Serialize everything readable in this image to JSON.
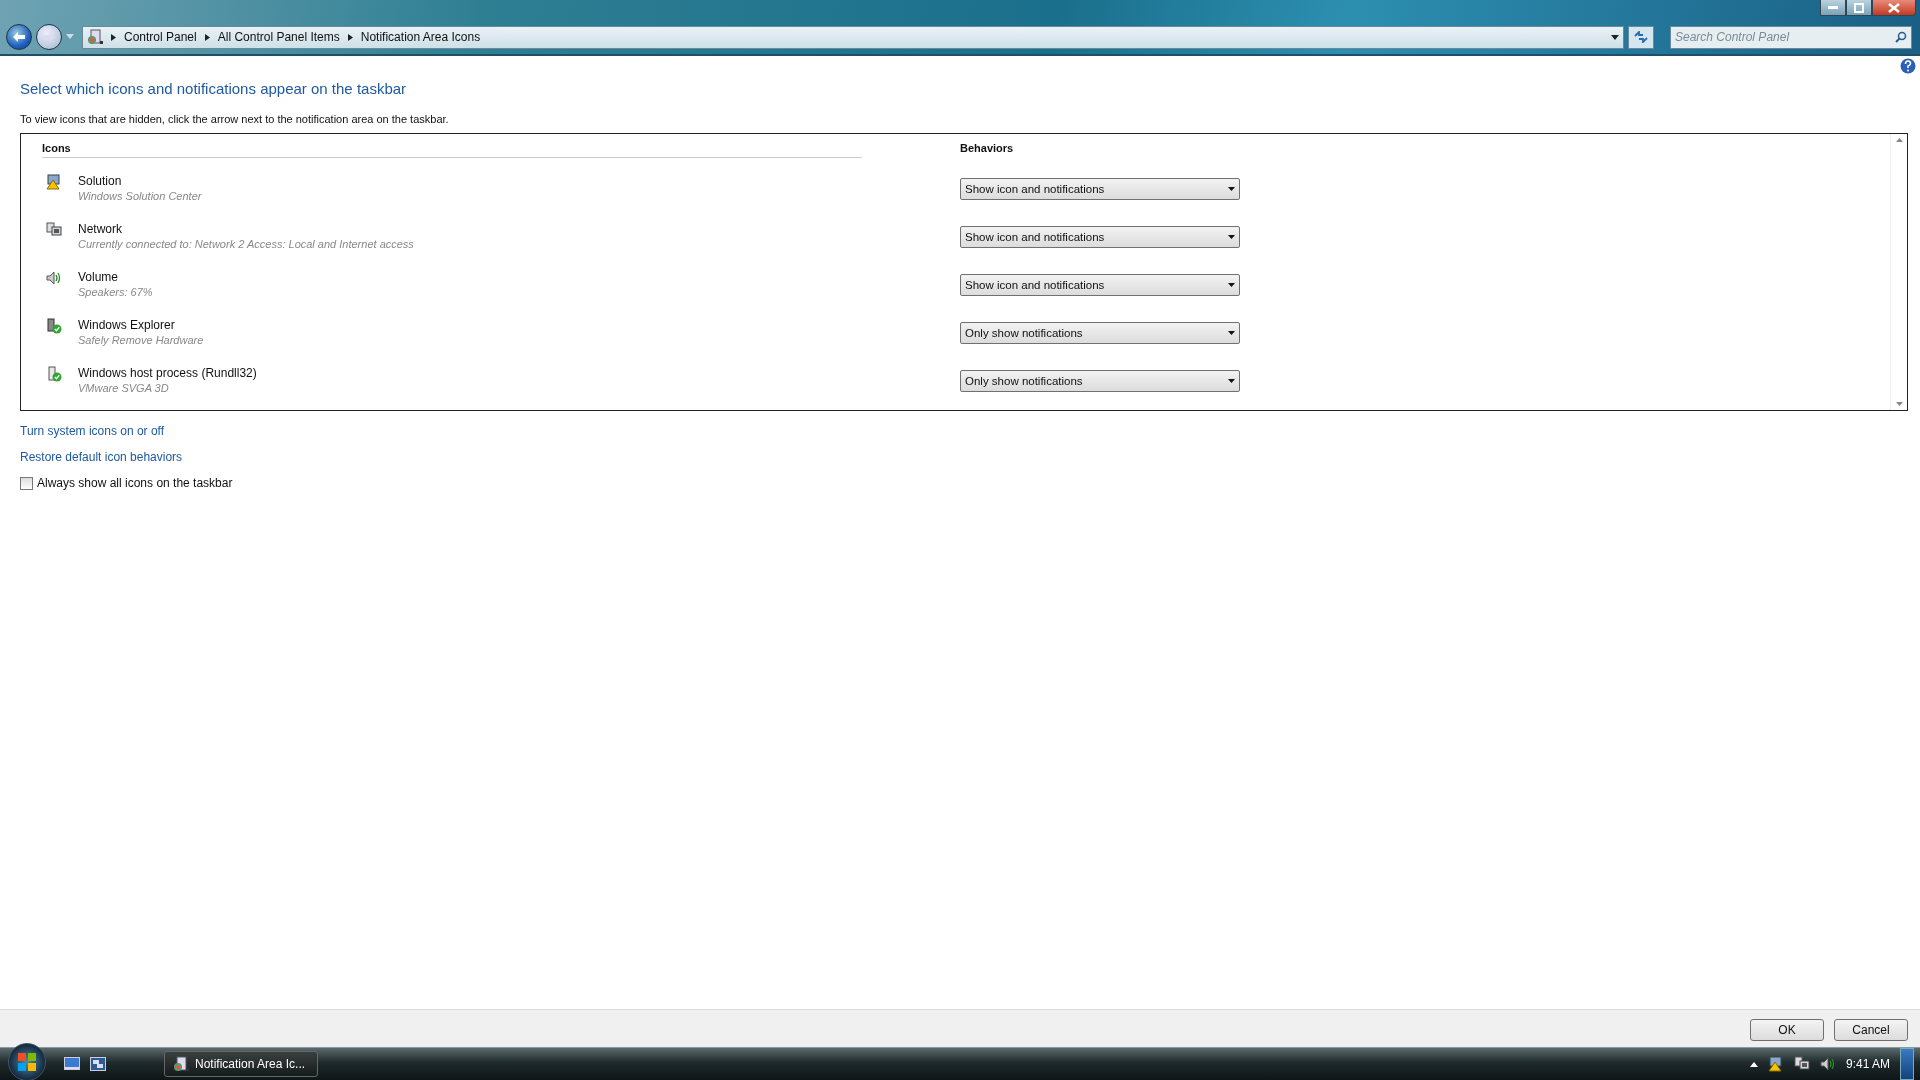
{
  "address_bar": {
    "breadcrumb": [
      "Control Panel",
      "All Control Panel Items",
      "Notification Area Icons"
    ]
  },
  "search": {
    "placeholder": "Search Control Panel"
  },
  "heading": "Select which icons and notifications appear on the taskbar",
  "description": "To view icons that are hidden, click the arrow next to the notification area on the taskbar.",
  "table": {
    "columns": [
      "Icons",
      "Behaviors"
    ],
    "rows": [
      {
        "name": "Solution",
        "detail": "Windows Solution Center",
        "behavior": "Show icon and notifications"
      },
      {
        "name": "Network",
        "detail": "Currently connected to: Network  2 Access:  Local and Internet access",
        "behavior": "Show icon and notifications"
      },
      {
        "name": "Volume",
        "detail": "Speakers: 67%",
        "behavior": "Show icon and notifications"
      },
      {
        "name": "Windows Explorer",
        "detail": "Safely Remove Hardware",
        "behavior": "Only show notifications"
      },
      {
        "name": "Windows host process (Rundll32)",
        "detail": "VMware SVGA 3D",
        "behavior": "Only show notifications"
      }
    ]
  },
  "links": [
    "Turn system icons on or off",
    "Restore default icon behaviors"
  ],
  "always_show": {
    "label": "Always show all icons on the taskbar",
    "checked": false
  },
  "buttons": [
    "OK",
    "Cancel"
  ],
  "taskbar": {
    "task": "Notification Area Ic...",
    "clock": "9:41 AM"
  }
}
